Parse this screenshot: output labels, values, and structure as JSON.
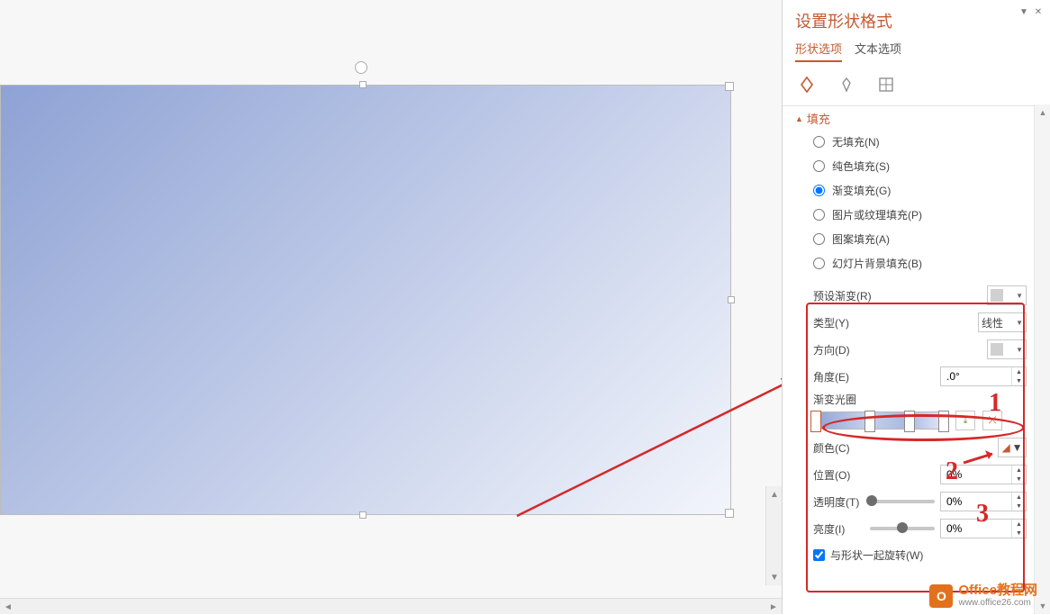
{
  "panel": {
    "title": "设置形状格式",
    "tabs": {
      "shape": "形状选项",
      "text": "文本选项"
    },
    "section": "填充",
    "fill_options": {
      "none": "无填充(N)",
      "solid": "纯色填充(S)",
      "gradient": "渐变填充(G)",
      "picture": "图片或纹理填充(P)",
      "pattern": "图案填充(A)",
      "slidebg": "幻灯片背景填充(B)"
    },
    "preset_label": "预设渐变(R)",
    "type_label": "类型(Y)",
    "type_value": "线性",
    "direction_label": "方向(D)",
    "angle_label": "角度(E)",
    "angle_value": ".0°",
    "stops_label": "渐变光圈",
    "color_label": "颜色(C)",
    "position_label": "位置(O)",
    "position_value": "0%",
    "transparency_label": "透明度(T)",
    "transparency_value": "0%",
    "brightness_label": "亮度(I)",
    "brightness_value": "0%",
    "rotate_label": "与形状一起旋转(W)"
  },
  "watermark": {
    "brand": "Office教程网",
    "url": "www.office26.com"
  },
  "annotations": {
    "n1": "1",
    "n2": "2",
    "n3": "3"
  }
}
